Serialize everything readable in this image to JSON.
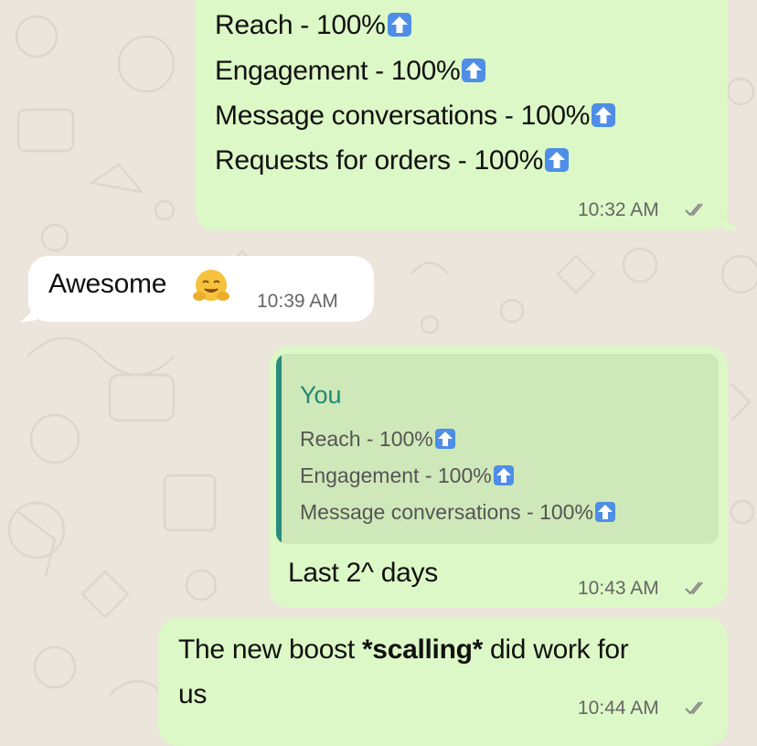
{
  "colors": {
    "outgoing_bubble": "#dcf8c6",
    "incoming_bubble": "#ffffff",
    "quote_accent": "#2a8c7c",
    "emoji_arrow": "#4e8ee6",
    "background": "#ebe5dc"
  },
  "messages": [
    {
      "direction": "out",
      "lines": [
        "Reach - 100%",
        "Engagement - 100%",
        "Message conversations - 100%",
        "Requests for orders - 100%"
      ],
      "line_emoji": "up-arrow-emoji",
      "time": "10:32 AM",
      "status_icon": "double-check-icon"
    },
    {
      "direction": "in",
      "text": "Awesome",
      "emoji": "hugging-face-emoji",
      "time": "10:39 AM"
    },
    {
      "direction": "out",
      "quote": {
        "author": "You",
        "lines": [
          "Reach - 100%",
          "Engagement - 100%",
          "Message conversations - 100%"
        ]
      },
      "text": "Last 2^ days",
      "time": "10:43 AM",
      "status_icon": "double-check-icon"
    },
    {
      "direction": "out",
      "text_before": "The new boost ",
      "text_bold": "*scalling*",
      "text_after": " did work for",
      "text_line2": "us",
      "time": "10:44 AM",
      "status_icon": "double-check-icon"
    }
  ]
}
